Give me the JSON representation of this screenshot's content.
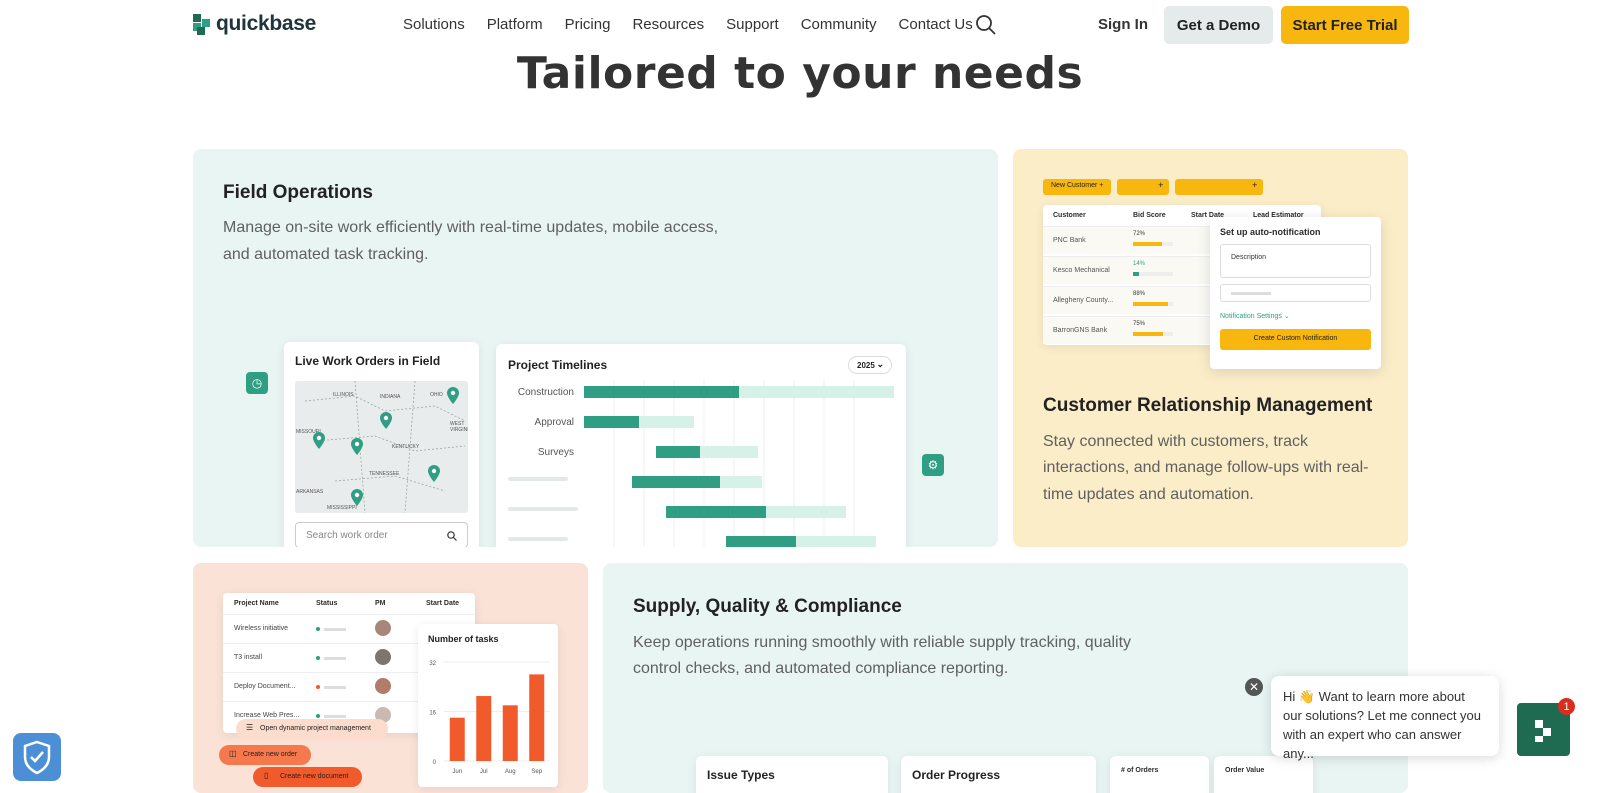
{
  "nav": {
    "logo_text": "quickbase",
    "menu": [
      "Solutions",
      "Platform",
      "Pricing",
      "Resources",
      "Support",
      "Community",
      "Contact Us"
    ],
    "sign_in": "Sign In",
    "get_demo": "Get a Demo",
    "start_trial": "Start Free Trial"
  },
  "headline": "Tailored to your needs",
  "cards": {
    "field_ops": {
      "title": "Field Operations",
      "desc_1": "Manage on-site work efficiently with real-time updates, mobile access,",
      "desc_2": "and automated task tracking.",
      "map_title": "Live Work Orders in Field",
      "search_placeholder": "Search work order",
      "states": [
        "ILLINOIS",
        "INDIANA",
        "OHIO",
        "MISSOURI",
        "KENTUCKY",
        "WEST VIRGINIA",
        "TENNESSEE",
        "ARKANSAS",
        "MISSISSIPPI"
      ],
      "timeline_title": "Project Timelines",
      "year": "2025",
      "rows": [
        "Construction",
        "Approval",
        "Surveys"
      ]
    },
    "crm": {
      "title": "Customer Relationship Management",
      "desc_1": "Stay connected with customers, track",
      "desc_2": "interactions, and manage follow-ups with real-",
      "desc_3": "time updates and automation.",
      "new_customer": "New Customer",
      "columns": [
        "Customer",
        "Bid Score",
        "Start Date",
        "Lead Estimator"
      ],
      "rows": [
        {
          "name": "PNC Bank",
          "score": "72%"
        },
        {
          "name": "Kesco Mechanical",
          "score": "14%"
        },
        {
          "name": "Allegheny County...",
          "score": "88%"
        },
        {
          "name": "BarronGNS Bank",
          "score": "75%"
        }
      ],
      "popup_title": "Set up auto-notification",
      "popup_field": "Description",
      "popup_settings": "Notification Settings",
      "popup_button": "Create Custom Notification"
    },
    "projects": {
      "columns": [
        "Project Name",
        "Status",
        "PM",
        "Start Date"
      ],
      "rows": [
        "Wireless initiative",
        "T3 install",
        "Deploy Document...",
        "Increase Web Pres..."
      ],
      "chart_title": "Number of tasks",
      "action_1": "Open dynamic project management",
      "action_2": "Create new order",
      "action_3": "Create new document"
    },
    "supply": {
      "title": "Supply, Quality & Compliance",
      "desc_1": "Keep operations running smoothly with reliable supply tracking, quality",
      "desc_2": "control checks, and automated compliance reporting.",
      "panel_1": "Issue Types",
      "panel_2": "Order Progress",
      "stat_1_label": "# of Orders",
      "stat_2_label": "Order Value"
    }
  },
  "chart_data": {
    "type": "bar",
    "title": "Number of tasks",
    "categories": [
      "Jun",
      "Jul",
      "Aug",
      "Sep"
    ],
    "values": [
      14,
      21,
      18,
      28
    ],
    "yticks": [
      "32",
      "16",
      "0"
    ],
    "ylim": [
      0,
      32
    ],
    "color": "#f15a2b"
  },
  "chat": {
    "message": "Hi 👋 Want to learn more about our solutions? Let me connect you with an expert who can answer any...",
    "badge": "1"
  }
}
